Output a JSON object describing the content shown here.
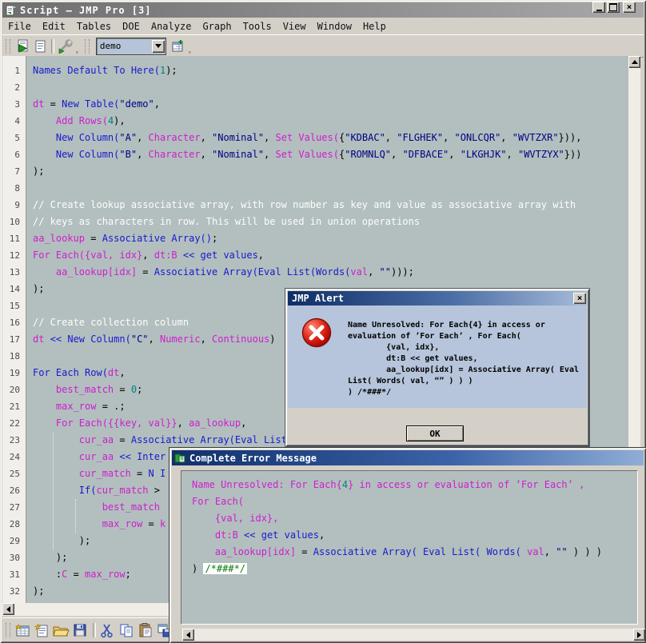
{
  "window": {
    "title": "Script – JMP Pro [3]",
    "menu": [
      "File",
      "Edit",
      "Tables",
      "DOE",
      "Analyze",
      "Graph",
      "Tools",
      "View",
      "Window",
      "Help"
    ],
    "toolbar": {
      "combo_value": "demo"
    }
  },
  "colors": {
    "editor_bg": "#b2bfbe",
    "chrome": "#d4d0c8",
    "alert_body": "#b6c5db",
    "function": "#1a1acc",
    "name": "#cf1ecf",
    "string": "#000082",
    "number": "#008080",
    "comment": "#fdfdfd",
    "plain": "#000000",
    "highlight_green": "#0a7a0a",
    "active_title_dark": "#10306b"
  },
  "editor": {
    "lines": [
      [
        [
          "Names Default To Here(",
          "f"
        ],
        [
          "1",
          "n"
        ],
        [
          ");",
          "p"
        ]
      ],
      [],
      [
        [
          "dt",
          "v"
        ],
        [
          " = ",
          "p"
        ],
        [
          "New Table(",
          "f"
        ],
        [
          "\"demo\"",
          "s"
        ],
        [
          ",",
          "p"
        ]
      ],
      [
        [
          "    ",
          "p"
        ],
        [
          "Add Rows(",
          "v"
        ],
        [
          "4",
          "n"
        ],
        [
          "),",
          "p"
        ]
      ],
      [
        [
          "    ",
          "p"
        ],
        [
          "New Column(",
          "f"
        ],
        [
          "\"A\"",
          "s"
        ],
        [
          ", ",
          "p"
        ],
        [
          "Character",
          "v"
        ],
        [
          ", ",
          "p"
        ],
        [
          "\"Nominal\"",
          "s"
        ],
        [
          ", ",
          "p"
        ],
        [
          "Set Values(",
          "v"
        ],
        [
          "{",
          "p"
        ],
        [
          "\"KDBAC\"",
          "s"
        ],
        [
          ", ",
          "p"
        ],
        [
          "\"FLGHEK\"",
          "s"
        ],
        [
          ", ",
          "p"
        ],
        [
          "\"ONLCQR\"",
          "s"
        ],
        [
          ", ",
          "p"
        ],
        [
          "\"WVTZXR\"",
          "s"
        ],
        [
          "})),",
          "p"
        ]
      ],
      [
        [
          "    ",
          "p"
        ],
        [
          "New Column(",
          "f"
        ],
        [
          "\"B\"",
          "s"
        ],
        [
          ", ",
          "p"
        ],
        [
          "Character",
          "v"
        ],
        [
          ", ",
          "p"
        ],
        [
          "\"Nominal\"",
          "s"
        ],
        [
          ", ",
          "p"
        ],
        [
          "Set Values(",
          "v"
        ],
        [
          "{",
          "p"
        ],
        [
          "\"ROMNLQ\"",
          "s"
        ],
        [
          ", ",
          "p"
        ],
        [
          "\"DFBACE\"",
          "s"
        ],
        [
          ", ",
          "p"
        ],
        [
          "\"LKGHJK\"",
          "s"
        ],
        [
          ", ",
          "p"
        ],
        [
          "\"WVTZYX\"",
          "s"
        ],
        [
          "}))",
          "p"
        ]
      ],
      [
        [
          ");",
          "p"
        ]
      ],
      [],
      [
        [
          "// Create lookup associative array, with row number as key and value as associative array with",
          "c"
        ]
      ],
      [
        [
          "// keys as characters in row. This will be used in union operations",
          "c"
        ]
      ],
      [
        [
          "aa_lookup",
          "v"
        ],
        [
          " = ",
          "p"
        ],
        [
          "Associative Array()",
          "f"
        ],
        [
          ";",
          "p"
        ]
      ],
      [
        [
          "For Each({val, idx}",
          "v"
        ],
        [
          ", ",
          "p"
        ],
        [
          "dt:B",
          "v"
        ],
        [
          " ",
          "p"
        ],
        [
          "<< get values",
          "f"
        ],
        [
          ",",
          "p"
        ]
      ],
      [
        [
          "    ",
          "p"
        ],
        [
          "aa_lookup[idx]",
          "v"
        ],
        [
          " = ",
          "p"
        ],
        [
          "Associative Array(Eval List(Words(",
          "f"
        ],
        [
          "val",
          "v"
        ],
        [
          ", ",
          "p"
        ],
        [
          "\"\"",
          "s"
        ],
        [
          ")));",
          "p"
        ]
      ],
      [
        [
          ");",
          "p"
        ]
      ],
      [],
      [
        [
          "// Create collection column",
          "c"
        ]
      ],
      [
        [
          "dt",
          "v"
        ],
        [
          " ",
          "p"
        ],
        [
          "<< New Column(",
          "f"
        ],
        [
          "\"C\"",
          "s"
        ],
        [
          ", ",
          "p"
        ],
        [
          "Numeric",
          "v"
        ],
        [
          ", ",
          "p"
        ],
        [
          "Continuous",
          "v"
        ],
        [
          ")",
          "p"
        ]
      ],
      [],
      [
        [
          "For Each Row(",
          "f"
        ],
        [
          "dt",
          "v"
        ],
        [
          ",",
          "p"
        ]
      ],
      [
        [
          "    ",
          "p"
        ],
        [
          "best_match",
          "v"
        ],
        [
          " = ",
          "p"
        ],
        [
          "0",
          "n"
        ],
        [
          ";",
          "p"
        ]
      ],
      [
        [
          "    ",
          "p"
        ],
        [
          "max_row",
          "v"
        ],
        [
          " = .;",
          "p"
        ]
      ],
      [
        [
          "    ",
          "p"
        ],
        [
          "For Each({{key, val}}",
          "v"
        ],
        [
          ", ",
          "p"
        ],
        [
          "aa_lookup",
          "v"
        ],
        [
          ",",
          "p"
        ]
      ],
      [
        [
          "        ",
          "p"
        ],
        [
          "cur_aa",
          "v"
        ],
        [
          " = ",
          "p"
        ],
        [
          "Associative Array(Eval List",
          "f"
        ]
      ],
      [
        [
          "        ",
          "p"
        ],
        [
          "cur_aa",
          "v"
        ],
        [
          " ",
          "p"
        ],
        [
          "<< Inter",
          "f"
        ]
      ],
      [
        [
          "        ",
          "p"
        ],
        [
          "cur_match",
          "v"
        ],
        [
          " = ",
          "p"
        ],
        [
          "N I",
          "f"
        ]
      ],
      [
        [
          "        ",
          "p"
        ],
        [
          "If(",
          "f"
        ],
        [
          "cur_match",
          "v"
        ],
        [
          " >",
          "p"
        ]
      ],
      [
        [
          "            ",
          "p"
        ],
        [
          "best_match",
          "v"
        ]
      ],
      [
        [
          "            ",
          "p"
        ],
        [
          "max_row",
          "v"
        ],
        [
          " = ",
          "p"
        ],
        [
          "k",
          "v"
        ]
      ],
      [
        [
          "        );",
          "p"
        ]
      ],
      [
        [
          "    );",
          "p"
        ]
      ],
      [
        [
          "    :",
          "p"
        ],
        [
          "C",
          "v"
        ],
        [
          " = ",
          "p"
        ],
        [
          "max_row",
          "v"
        ],
        [
          ";",
          "p"
        ]
      ],
      [
        [
          ");",
          "p"
        ]
      ]
    ]
  },
  "alert": {
    "title": "JMP Alert",
    "lines": [
      "Name Unresolved: For Each{4} in access or",
      "evaluation of ’For Each’ , For Each(",
      "        {val, idx},",
      "        dt:B << get values,",
      "        aa_lookup[idx] = Associative Array( Eval",
      "List( Words( val, “” ) ) )",
      ") /*###*/"
    ],
    "ok_label": "OK"
  },
  "error_window": {
    "title": "Complete Error Message",
    "lines": [
      [
        [
          "Name Unresolved: For Each{",
          "v"
        ],
        [
          "4",
          "n"
        ],
        [
          "} in access or evaluation of ’For Each’ ,",
          "v"
        ]
      ],
      [
        [
          "For Each(",
          "v"
        ]
      ],
      [
        [
          "    {val, idx},",
          "v"
        ]
      ],
      [
        [
          "    ",
          "p"
        ],
        [
          "dt:B",
          "v"
        ],
        [
          " ",
          "p"
        ],
        [
          "<< get values",
          "f"
        ],
        [
          ",",
          "p"
        ]
      ],
      [
        [
          "    ",
          "p"
        ],
        [
          "aa_lookup[idx]",
          "v"
        ],
        [
          " = ",
          "p"
        ],
        [
          "Associative Array( Eval List( Words( ",
          "f"
        ],
        [
          "val",
          "v"
        ],
        [
          ", ",
          "p"
        ],
        [
          "\"\" ",
          "s"
        ],
        [
          ") ) )",
          "p"
        ]
      ],
      [
        [
          ") ",
          "p"
        ],
        [
          "/*###*/",
          "g"
        ]
      ]
    ]
  }
}
